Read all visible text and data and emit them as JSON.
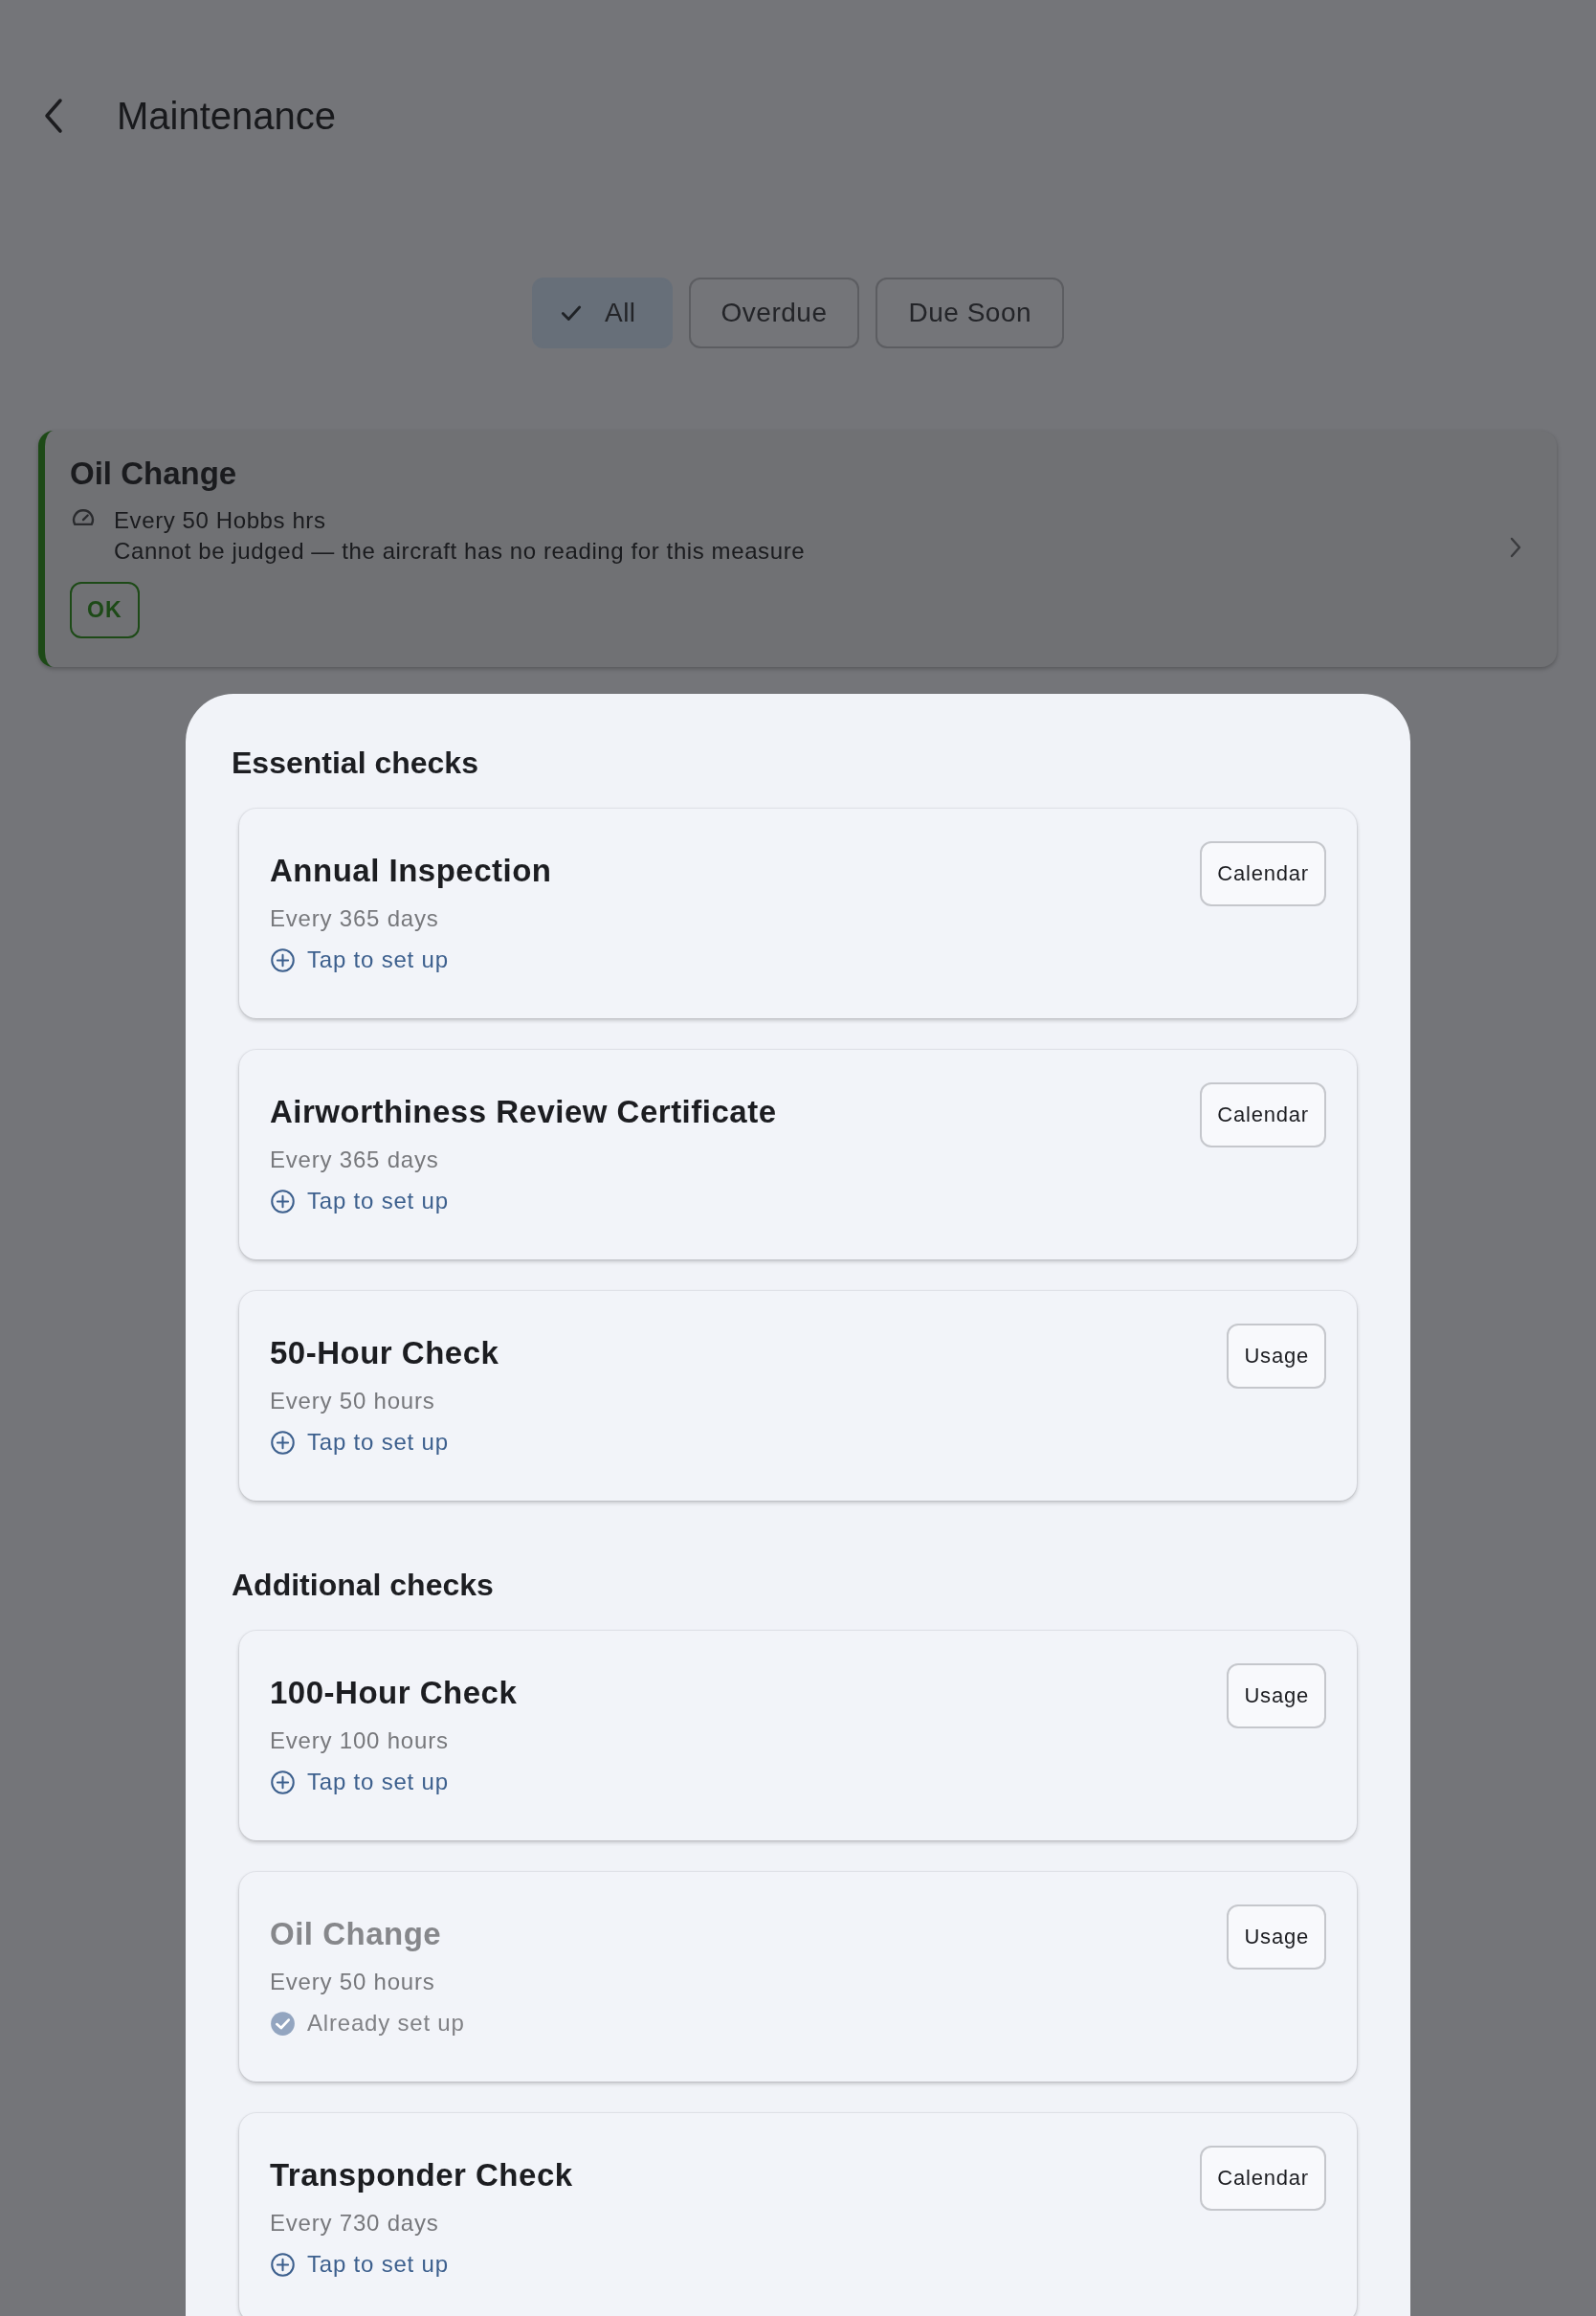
{
  "header": {
    "title": "Maintenance"
  },
  "filters": [
    {
      "label": "All",
      "selected": true
    },
    {
      "label": "Overdue",
      "selected": false
    },
    {
      "label": "Due Soon",
      "selected": false
    }
  ],
  "tasks": [
    {
      "title": "Oil Change",
      "interval": "Every 50 Hobbs hrs",
      "note": "Cannot be judged — the aircraft has no reading for this measure",
      "status": "OK",
      "color": "#1d4a17"
    }
  ],
  "sheet": {
    "sections": [
      {
        "heading": "Essential checks",
        "items": [
          {
            "title": "Annual Inspection",
            "interval": "Every 365 days",
            "type": "Calendar",
            "action": "Tap to set up",
            "configured": false
          },
          {
            "title": "Airworthiness Review Certificate",
            "interval": "Every 365 days",
            "type": "Calendar",
            "action": "Tap to set up",
            "configured": false
          },
          {
            "title": "50-Hour Check",
            "interval": "Every 50 hours",
            "type": "Usage",
            "action": "Tap to set up",
            "configured": false
          }
        ]
      },
      {
        "heading": "Additional checks",
        "items": [
          {
            "title": "100-Hour Check",
            "interval": "Every 100 hours",
            "type": "Usage",
            "action": "Tap to set up",
            "configured": false
          },
          {
            "title": "Oil Change",
            "interval": "Every 50 hours",
            "type": "Usage",
            "action": "Already set up",
            "configured": true
          },
          {
            "title": "Transponder Check",
            "interval": "Every 730 days",
            "type": "Calendar",
            "action": "Tap to set up",
            "configured": false
          }
        ]
      }
    ]
  }
}
